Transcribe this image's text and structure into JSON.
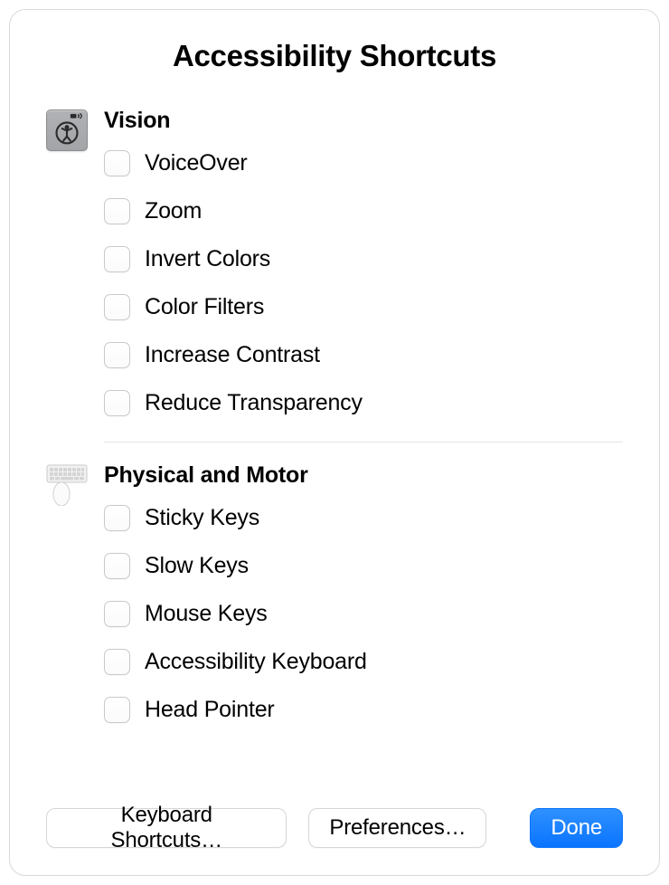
{
  "title": "Accessibility Shortcuts",
  "sections": [
    {
      "id": "vision",
      "title": "Vision",
      "items": [
        {
          "label": "VoiceOver",
          "checked": false
        },
        {
          "label": "Zoom",
          "checked": false
        },
        {
          "label": "Invert Colors",
          "checked": false
        },
        {
          "label": "Color Filters",
          "checked": false
        },
        {
          "label": "Increase Contrast",
          "checked": false
        },
        {
          "label": "Reduce Transparency",
          "checked": false
        }
      ]
    },
    {
      "id": "physical_motor",
      "title": "Physical and Motor",
      "items": [
        {
          "label": "Sticky Keys",
          "checked": false
        },
        {
          "label": "Slow Keys",
          "checked": false
        },
        {
          "label": "Mouse Keys",
          "checked": false
        },
        {
          "label": "Accessibility Keyboard",
          "checked": false
        },
        {
          "label": "Head Pointer",
          "checked": false
        }
      ]
    }
  ],
  "footer": {
    "keyboard_shortcuts_label": "Keyboard Shortcuts…",
    "preferences_label": "Preferences…",
    "done_label": "Done"
  },
  "colors": {
    "primary": "#0a74ff"
  }
}
